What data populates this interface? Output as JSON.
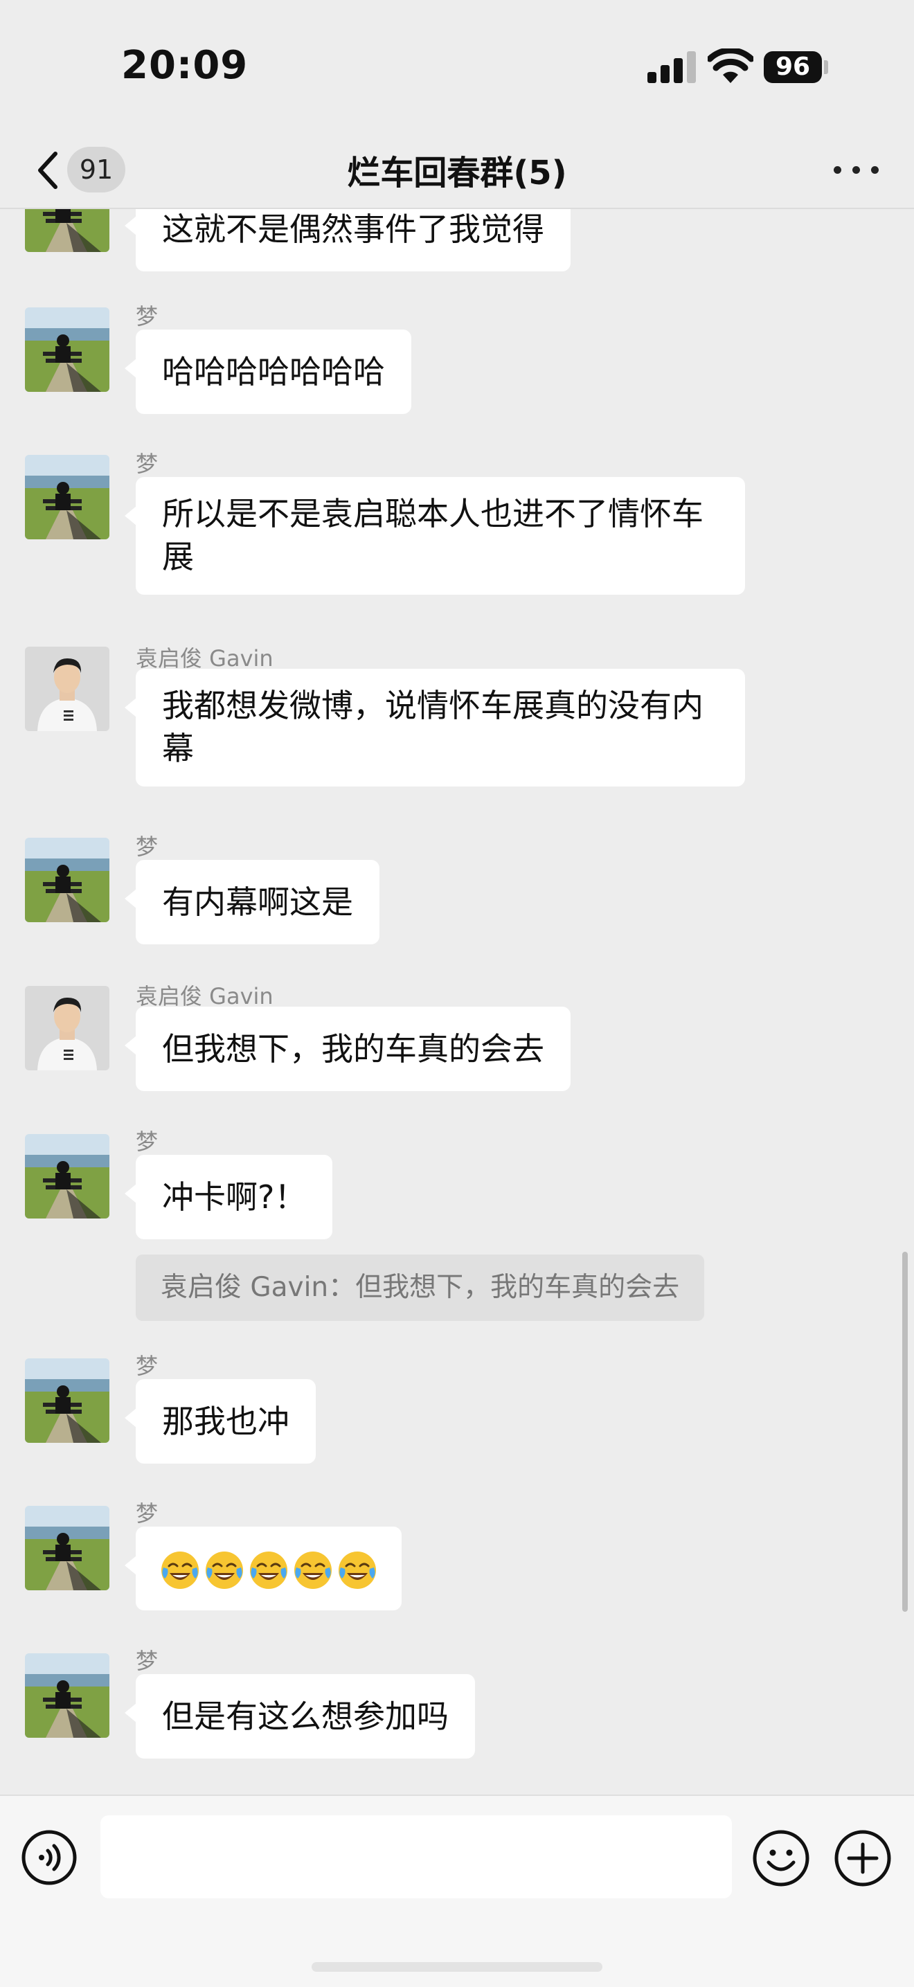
{
  "status_bar": {
    "time": "20:09",
    "battery": "96"
  },
  "nav": {
    "unread_count": "91",
    "title": "烂车回春群(5)"
  },
  "messages": [
    {
      "sender": "",
      "text": "这就不是偶然事件了我觉得"
    },
    {
      "sender": "梦",
      "text": "哈哈哈哈哈哈哈"
    },
    {
      "sender": "梦",
      "text": "所以是不是袁启聪本人也进不了情怀车展"
    },
    {
      "sender": "袁启俊 Gavin",
      "text": "我都想发微博，说情怀车展真的没有内幕"
    },
    {
      "sender": "梦",
      "text": "有内幕啊这是"
    },
    {
      "sender": "袁启俊 Gavin",
      "text": "但我想下，我的车真的会去"
    },
    {
      "sender": "梦",
      "text": "冲卡啊?！",
      "quote": "袁启俊 Gavin：但我想下，我的车真的会去"
    },
    {
      "sender": "梦",
      "text": "那我也冲"
    },
    {
      "sender": "梦",
      "emoji": "face-with-tears-of-joy",
      "emoji_count": 5
    },
    {
      "sender": "梦",
      "text": "但是有这么想参加吗"
    }
  ],
  "colors": {
    "background": "#ededed",
    "bubble": "#ffffff",
    "quote_bg": "#e0e0e0"
  }
}
